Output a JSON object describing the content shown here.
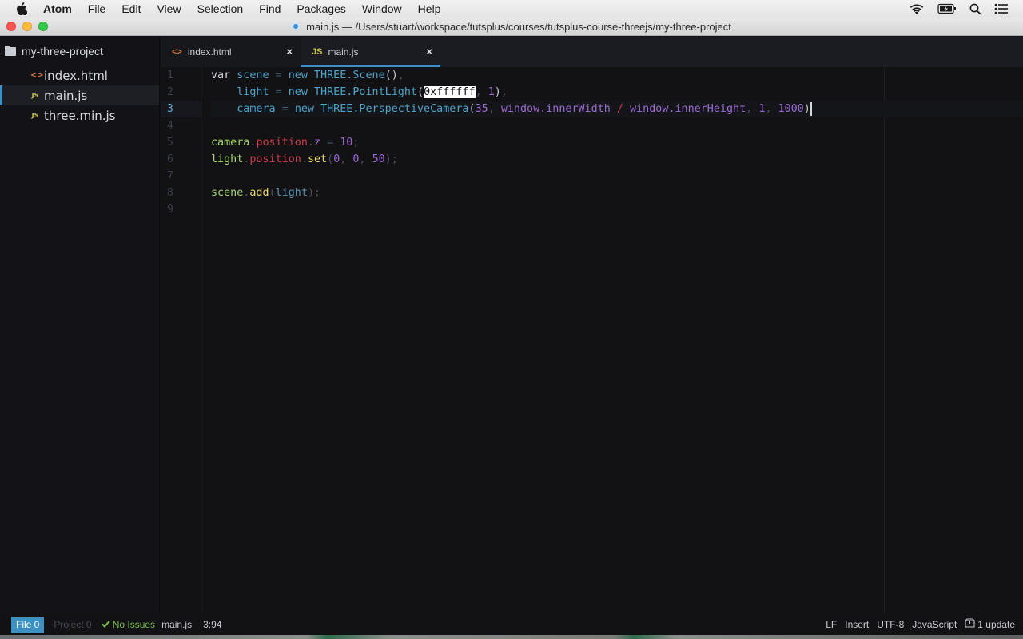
{
  "menubar": {
    "app_name": "Atom",
    "items": [
      "File",
      "Edit",
      "View",
      "Selection",
      "Find",
      "Packages",
      "Window",
      "Help"
    ],
    "status_icons": [
      "wifi-icon",
      "battery-icon",
      "spotlight-search-icon",
      "notification-center-icon"
    ]
  },
  "window": {
    "title": "main.js — /Users/stuart/workspace/tutsplus/courses/tutsplus-course-threejs/my-three-project"
  },
  "tree": {
    "root": "my-three-project",
    "items": [
      {
        "name": "index.html",
        "type": "html",
        "icon_glyph": "<>"
      },
      {
        "name": "main.js",
        "type": "js",
        "icon_glyph": "JS",
        "selected": true
      },
      {
        "name": "three.min.js",
        "type": "js",
        "icon_glyph": "JS"
      }
    ]
  },
  "tabs": [
    {
      "label": "index.html",
      "icon_glyph": "<>",
      "active": false,
      "close": "×"
    },
    {
      "label": "main.js",
      "icon_glyph": "JS",
      "active": true,
      "close": "×"
    }
  ],
  "editor": {
    "line_numbers": [
      "1",
      "2",
      "3",
      "4",
      "5",
      "6",
      "7",
      "8",
      "9"
    ],
    "current_line": 3,
    "lines": [
      "var scene = new THREE.Scene(),",
      "    light = new THREE.PointLight(0xffffff, 1),",
      "    camera = new THREE.PerspectiveCamera(35, window.innerWidth / window.innerHeight, 1, 1000)",
      "",
      "camera.position.z = 10;",
      "light.position.set(0, 0, 50);",
      "",
      "scene.add(light);",
      ""
    ],
    "selected_text": "0xffffff",
    "tokens": {
      "l1": {
        "kw": "var",
        "v1": "scene",
        "eq": "=",
        "new": "new",
        "cls": "THREE.Scene",
        "parens": "()",
        "comma": ","
      },
      "l2": {
        "v": "light",
        "eq": "=",
        "new": "new",
        "cls": "THREE.PointLight",
        "open": "(",
        "sel": "0xffffff",
        "c1": ", ",
        "n1": "1",
        "close": ")",
        "comma": ","
      },
      "l3": {
        "v": "camera",
        "eq": "=",
        "new": "new",
        "cls": "THREE.PerspectiveCamera",
        "open": "(",
        "n1": "35",
        "c1": ", ",
        "a1": "window.innerWidth",
        "div": " / ",
        "a2": "window.innerHeight",
        "c2": ", ",
        "n2": "1",
        "c3": ", ",
        "n3": "1000",
        "close": ")"
      },
      "l5": {
        "obj": "camera",
        "dot1": ".",
        "prop": "position",
        "dot2": ".",
        "z": "z",
        "eq": " = ",
        "n": "10",
        "semi": ";"
      },
      "l6": {
        "obj": "light",
        "dot1": ".",
        "prop": "position",
        "dot2": ".",
        "m": "set",
        "open": "(",
        "n1": "0",
        "c1": ", ",
        "n2": "0",
        "c2": ", ",
        "n3": "50",
        "close": ")",
        "semi": ";"
      },
      "l8": {
        "obj": "scene",
        "dot": ".",
        "m": "add",
        "open": "(",
        "arg": "light",
        "close": ")",
        "semi": ";"
      }
    }
  },
  "statusbar": {
    "file_badge": "File 0",
    "project_badge": "Project 0",
    "issues": "No Issues",
    "filename": "main.js",
    "cursor_position": "3:94",
    "line_ending": "LF",
    "mode": "Insert",
    "encoding": "UTF-8",
    "grammar": "JavaScript",
    "updates": "1 update"
  },
  "colors": {
    "accent": "#3d91c2",
    "issues_ok": "#7bbf4a",
    "editor_bg": "#121215"
  }
}
